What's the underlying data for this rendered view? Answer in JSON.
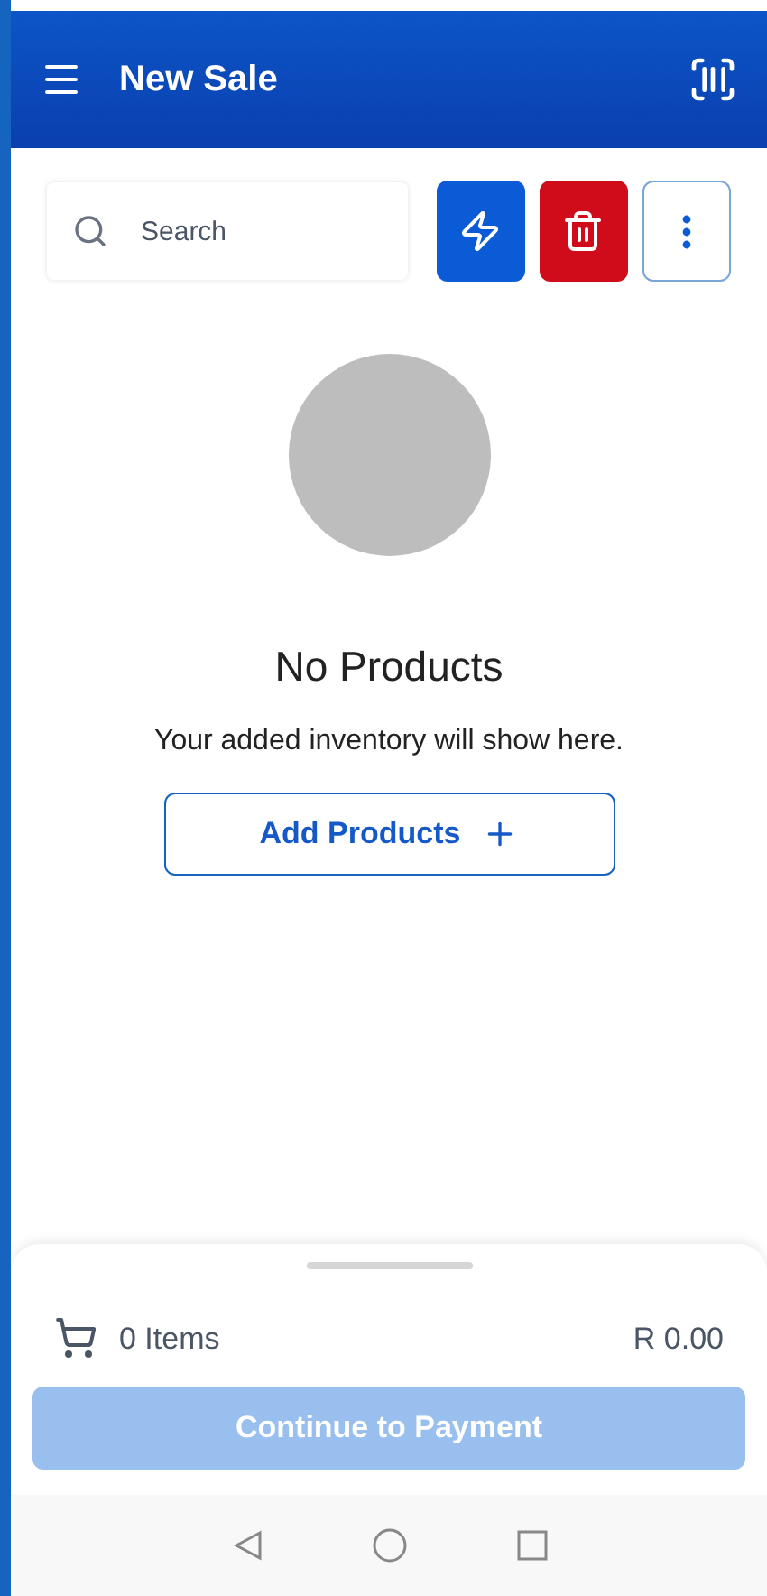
{
  "header": {
    "title": "New Sale"
  },
  "search": {
    "placeholder": "Search"
  },
  "empty_state": {
    "title": "No Products",
    "message": "Your added inventory will show here.",
    "button": "Add Products"
  },
  "cart": {
    "count": "0 Items",
    "total": "R 0.00"
  },
  "continue_button": {
    "label": "Continue to Payment",
    "disabled": true
  }
}
